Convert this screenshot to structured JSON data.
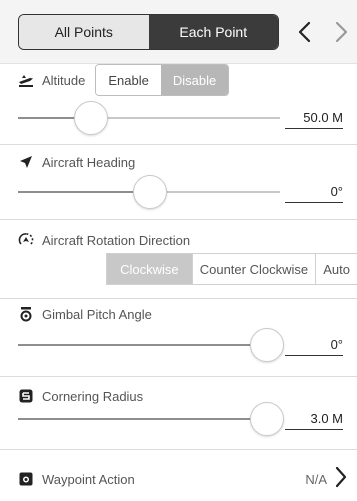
{
  "mode_tabs": {
    "all_points": "All Points",
    "each_point": "Each Point"
  },
  "nav": {
    "prev": "‹",
    "next": "›"
  },
  "altitude": {
    "label": "Altitude",
    "enable_label": "Enable",
    "disable_label": "Disable",
    "selected": "Disable",
    "value": "50.0 M",
    "slider_level": 0.21
  },
  "heading": {
    "label": "Aircraft Heading",
    "value": "0",
    "unit": "°",
    "slider_level": 0.49
  },
  "rotation": {
    "label": "Aircraft Rotation Direction",
    "options": [
      "Clockwise",
      "Counter Clockwise",
      "Auto"
    ],
    "selected": "Clockwise"
  },
  "gimbal": {
    "label": "Gimbal Pitch Angle",
    "value": "0",
    "unit": "°",
    "slider_level": 1.0
  },
  "cornering": {
    "label": "Cornering Radius",
    "value": "3.0 M",
    "slider_level": 1.0
  },
  "waypoint_action": {
    "label": "Waypoint Action",
    "value": "N/A"
  },
  "colors": {
    "accent_dark": "#3b3b3b",
    "selected_gray": "#b7b7b7"
  }
}
